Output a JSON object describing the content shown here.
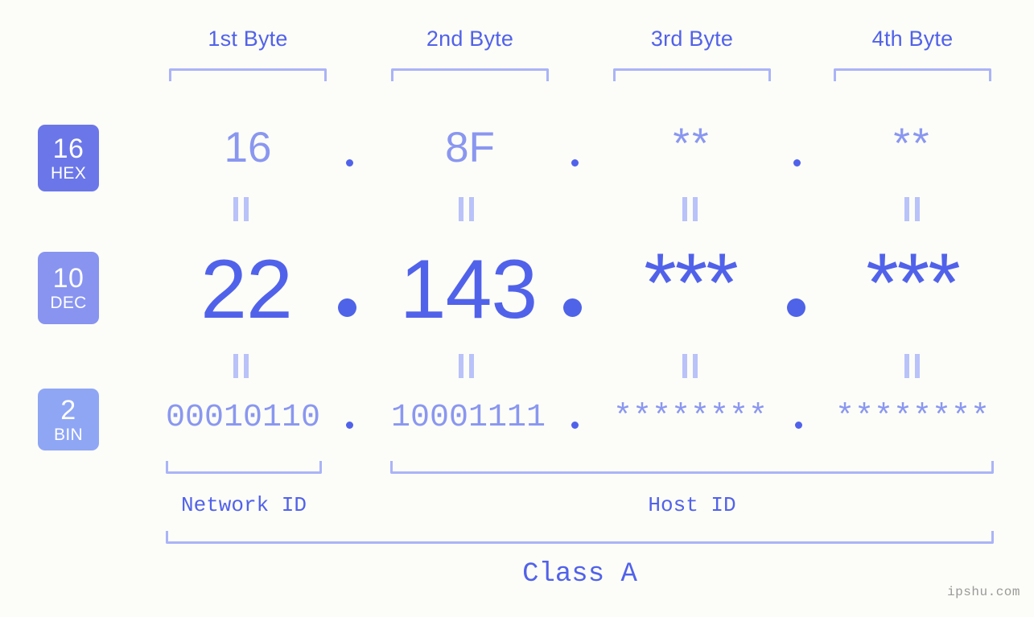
{
  "background_color": "#fcfdf8",
  "accent_colors": {
    "strong": "#5162ea",
    "medium": "#8a97f0",
    "light": "#aab4f7",
    "faint": "#b9c2f9"
  },
  "columns": [
    {
      "label": "1st Byte"
    },
    {
      "label": "2nd Byte"
    },
    {
      "label": "3rd Byte"
    },
    {
      "label": "4th Byte"
    }
  ],
  "rows": {
    "hex": {
      "badge_base": "16",
      "badge_name": "HEX",
      "badge_color": "#6b77e8",
      "values": [
        "16",
        "8F",
        "**",
        "**"
      ],
      "separator": "."
    },
    "dec": {
      "badge_base": "10",
      "badge_name": "DEC",
      "badge_color": "#8894f0",
      "values": [
        "22",
        "143",
        "***",
        "***"
      ],
      "separator": "."
    },
    "bin": {
      "badge_base": "2",
      "badge_name": "BIN",
      "badge_color": "#8fa6f5",
      "values": [
        "00010110",
        "10001111",
        "********",
        "********"
      ],
      "separator": "."
    }
  },
  "equality_marks": {
    "glyph": "||",
    "count_per_row_gap": 4
  },
  "segments": {
    "network_id": "Network ID",
    "host_id": "Host ID",
    "class": "Class A"
  },
  "watermark": "ipshu.com"
}
